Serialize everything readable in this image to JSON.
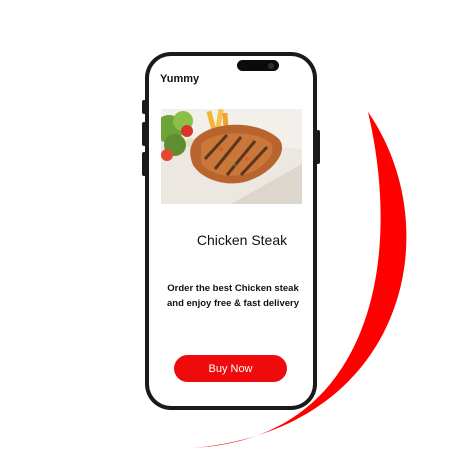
{
  "app": {
    "title": "Yummy"
  },
  "product": {
    "name": "Chicken Steak",
    "description_line1": "Order the best Chicken steak",
    "description_line2": "and enjoy free & fast delivery",
    "image_icon": "food-photo"
  },
  "actions": {
    "buy_label": "Buy Now"
  },
  "colors": {
    "accent": "#ef0b0b",
    "phone_frame": "#1a1a1a",
    "background": "#ffffff"
  }
}
